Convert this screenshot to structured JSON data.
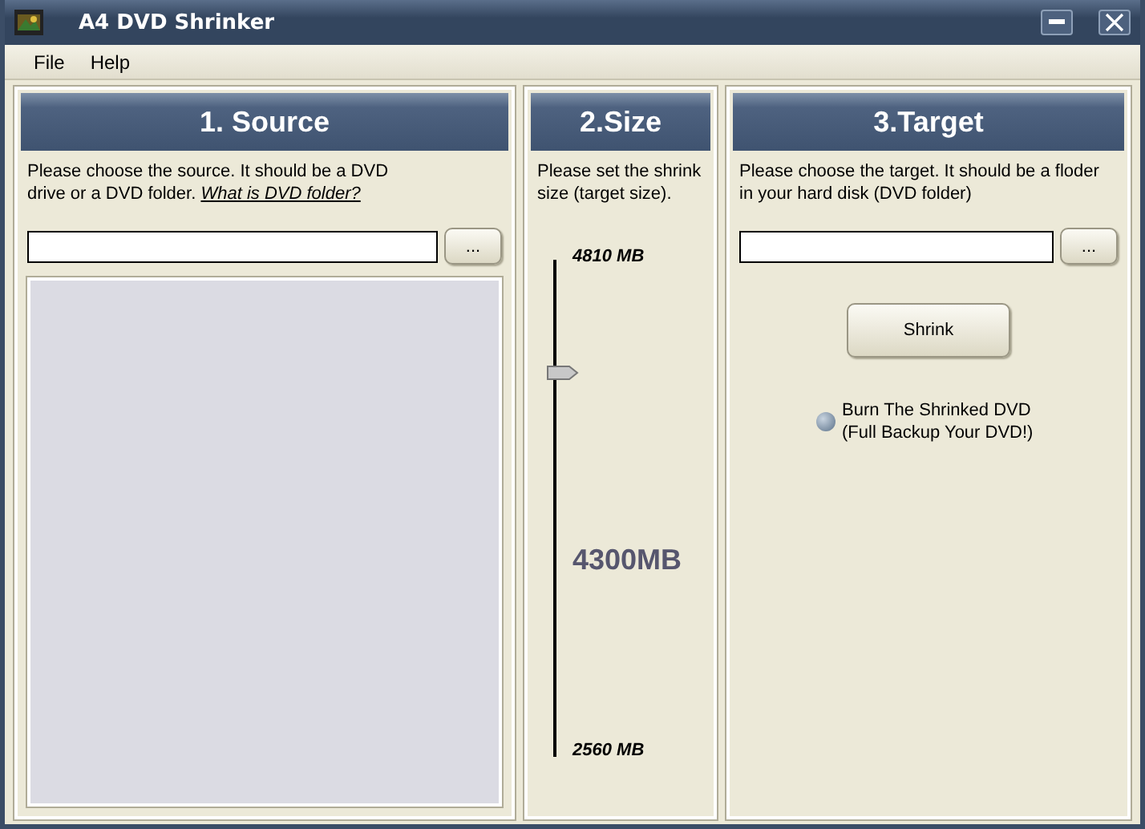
{
  "window": {
    "title": "A4 DVD Shrinker"
  },
  "menu": [
    "File",
    "Help"
  ],
  "source": {
    "heading": "1. Source",
    "instructions": "Please choose the source. It should be a DVD drive or a DVD folder.",
    "link": "What is DVD folder?",
    "browse": "..."
  },
  "size": {
    "heading": "2.Size",
    "instructions": "Please set the shrink size (target size).",
    "max": "4810 MB",
    "min": "2560 MB",
    "current": "4300MB",
    "level": 0.77
  },
  "target": {
    "heading": "3.Target",
    "instructions": "Please choose the target. It should be a floder in your hard disk (DVD folder)",
    "browse": "...",
    "action": "Shrink",
    "burn": {
      "label": "Burn The Shrinked DVD (Full Backup Your DVD!)",
      "checked": false
    }
  }
}
